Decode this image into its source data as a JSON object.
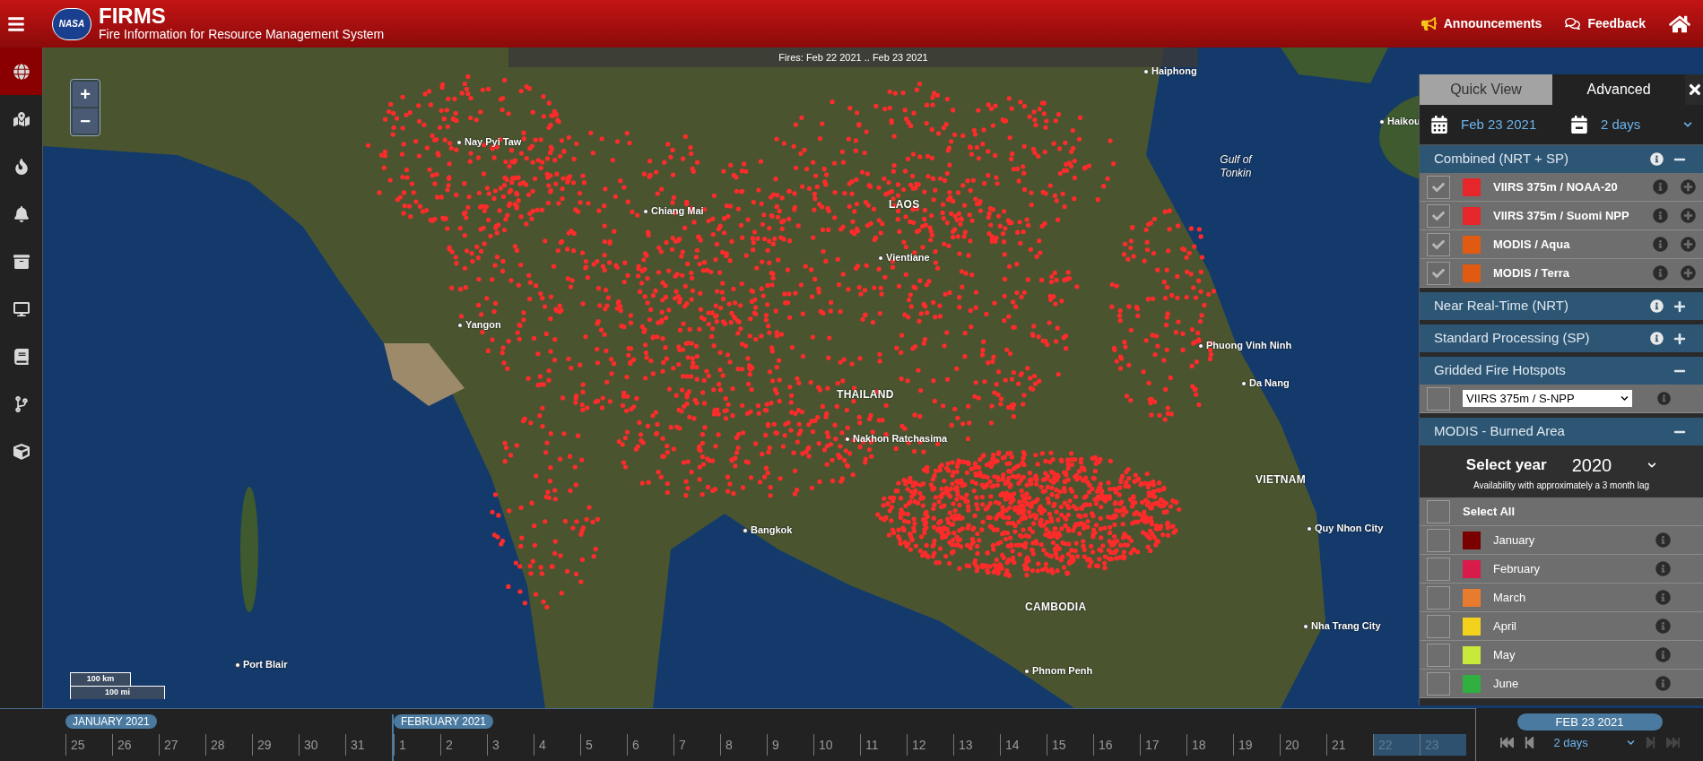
{
  "header": {
    "logo_text": "NASA",
    "title": "FIRMS",
    "subtitle": "Fire Information for Resource Management System",
    "links": [
      {
        "kind": "announce",
        "label": "Announcements"
      },
      {
        "kind": "feedback",
        "label": "Feedback"
      }
    ]
  },
  "sidebar": {
    "items": [
      {
        "selected": true
      },
      {
        "selected": false
      },
      {
        "selected": false
      },
      {
        "selected": false
      },
      {
        "selected": false
      },
      {
        "selected": false
      },
      {
        "selected": false
      },
      {
        "selected": false
      },
      {
        "selected": false
      }
    ]
  },
  "map": {
    "overlay": "Fires: Feb 22 2021 .. Feb 23 2021",
    "zoom": [
      "+",
      "−"
    ],
    "scale": [
      "100 km",
      "100 mi"
    ],
    "labels": [
      {
        "text": "Haiphong",
        "kind": "city"
      },
      {
        "text": "Haikou",
        "kind": "city"
      },
      {
        "text": "Gulf of Tonkin",
        "kind": "water"
      },
      {
        "text": "Nay Pyi Taw",
        "kind": "city"
      },
      {
        "text": "Chiang Mai",
        "kind": "city"
      },
      {
        "text": "LAOS",
        "kind": "country"
      },
      {
        "text": "Vientiane",
        "kind": "city"
      },
      {
        "text": "Yangon",
        "kind": "city"
      },
      {
        "text": "Phuong Vinh Ninh",
        "kind": "city"
      },
      {
        "text": "Da Nang",
        "kind": "city"
      },
      {
        "text": "THAILAND",
        "kind": "country"
      },
      {
        "text": "Nakhon Ratchasima",
        "kind": "city"
      },
      {
        "text": "VIETNAM",
        "kind": "country"
      },
      {
        "text": "Bangkok",
        "kind": "city"
      },
      {
        "text": "Quy Nhon City",
        "kind": "city"
      },
      {
        "text": "CAMBODIA",
        "kind": "country"
      },
      {
        "text": "Nha Trang City",
        "kind": "city"
      },
      {
        "text": "Port Blair",
        "kind": "city"
      },
      {
        "text": "Phnom Penh",
        "kind": "city"
      }
    ]
  },
  "panel": {
    "tabs": [
      {
        "label": "Quick View",
        "selected": false
      },
      {
        "label": "Advanced",
        "selected": true
      }
    ],
    "date": "Feb 23 2021",
    "range": "2 days",
    "sections": [
      {
        "kind": "layers",
        "title": "Combined (NRT + SP)",
        "info": true,
        "expanded": true,
        "items": [
          {
            "label": "VIIRS 375m / NOAA-20",
            "color": "#e5262a",
            "checked": true
          },
          {
            "label": "VIIRS 375m / Suomi NPP",
            "color": "#e5262a",
            "checked": true
          },
          {
            "label": "MODIS / Aqua",
            "color": "#e05a12",
            "checked": true
          },
          {
            "label": "MODIS / Terra",
            "color": "#e05a12",
            "checked": true
          }
        ]
      },
      {
        "title": "Near Real-Time (NRT)",
        "info": true,
        "expanded": false
      },
      {
        "title": "Standard Processing (SP)",
        "info": true,
        "expanded": false
      },
      {
        "kind": "gridded",
        "title": "Gridded Fire Hotspots",
        "info": false,
        "expanded": true,
        "checked": false,
        "value": "VIIRS 375m / S-NPP"
      },
      {
        "kind": "burned",
        "title": "MODIS - Burned Area",
        "info": false,
        "expanded": true,
        "year_label": "Select year",
        "year": "2020",
        "note": "Availability with approximately a 3 month lag",
        "select_all": {
          "label": "Select All",
          "checked": false
        },
        "items": [
          {
            "label": "January",
            "color": "#7a0000",
            "checked": false
          },
          {
            "label": "February",
            "color": "#d81b4a",
            "checked": false
          },
          {
            "label": "March",
            "color": "#e87c2e",
            "checked": false
          },
          {
            "label": "April",
            "color": "#f2d21c",
            "checked": false
          },
          {
            "label": "May",
            "color": "#c8e83a",
            "checked": false
          },
          {
            "label": "June",
            "color": "#30b040",
            "checked": false
          }
        ]
      }
    ]
  },
  "timeline": {
    "months": [
      {
        "label": "JANUARY 2021",
        "days": [
          {
            "label": "25",
            "selected": false
          },
          {
            "label": "26",
            "selected": false
          },
          {
            "label": "27",
            "selected": false
          },
          {
            "label": "28",
            "selected": false
          },
          {
            "label": "29",
            "selected": false
          },
          {
            "label": "30",
            "selected": false
          },
          {
            "label": "31",
            "selected": false
          }
        ]
      },
      {
        "label": "FEBRUARY 2021",
        "days": [
          {
            "label": "1",
            "selected": false
          },
          {
            "label": "2",
            "selected": false
          },
          {
            "label": "3",
            "selected": false
          },
          {
            "label": "4",
            "selected": false
          },
          {
            "label": "5",
            "selected": false
          },
          {
            "label": "6",
            "selected": false
          },
          {
            "label": "7",
            "selected": false
          },
          {
            "label": "8",
            "selected": false
          },
          {
            "label": "9",
            "selected": false
          },
          {
            "label": "10",
            "selected": false
          },
          {
            "label": "11",
            "selected": false
          },
          {
            "label": "12",
            "selected": false
          },
          {
            "label": "13",
            "selected": false
          },
          {
            "label": "14",
            "selected": false
          },
          {
            "label": "15",
            "selected": false
          },
          {
            "label": "16",
            "selected": false
          },
          {
            "label": "17",
            "selected": false
          },
          {
            "label": "18",
            "selected": false
          },
          {
            "label": "19",
            "selected": false
          },
          {
            "label": "20",
            "selected": false
          },
          {
            "label": "21",
            "selected": false
          },
          {
            "label": "22",
            "selected": true
          },
          {
            "label": "23",
            "selected": true
          }
        ]
      }
    ],
    "date": "FEB 23 2021",
    "range": "2 days",
    "playback": [
      {
        "disabled": false
      },
      {
        "disabled": false
      },
      {
        "disabled": true
      },
      {
        "disabled": true
      }
    ]
  }
}
